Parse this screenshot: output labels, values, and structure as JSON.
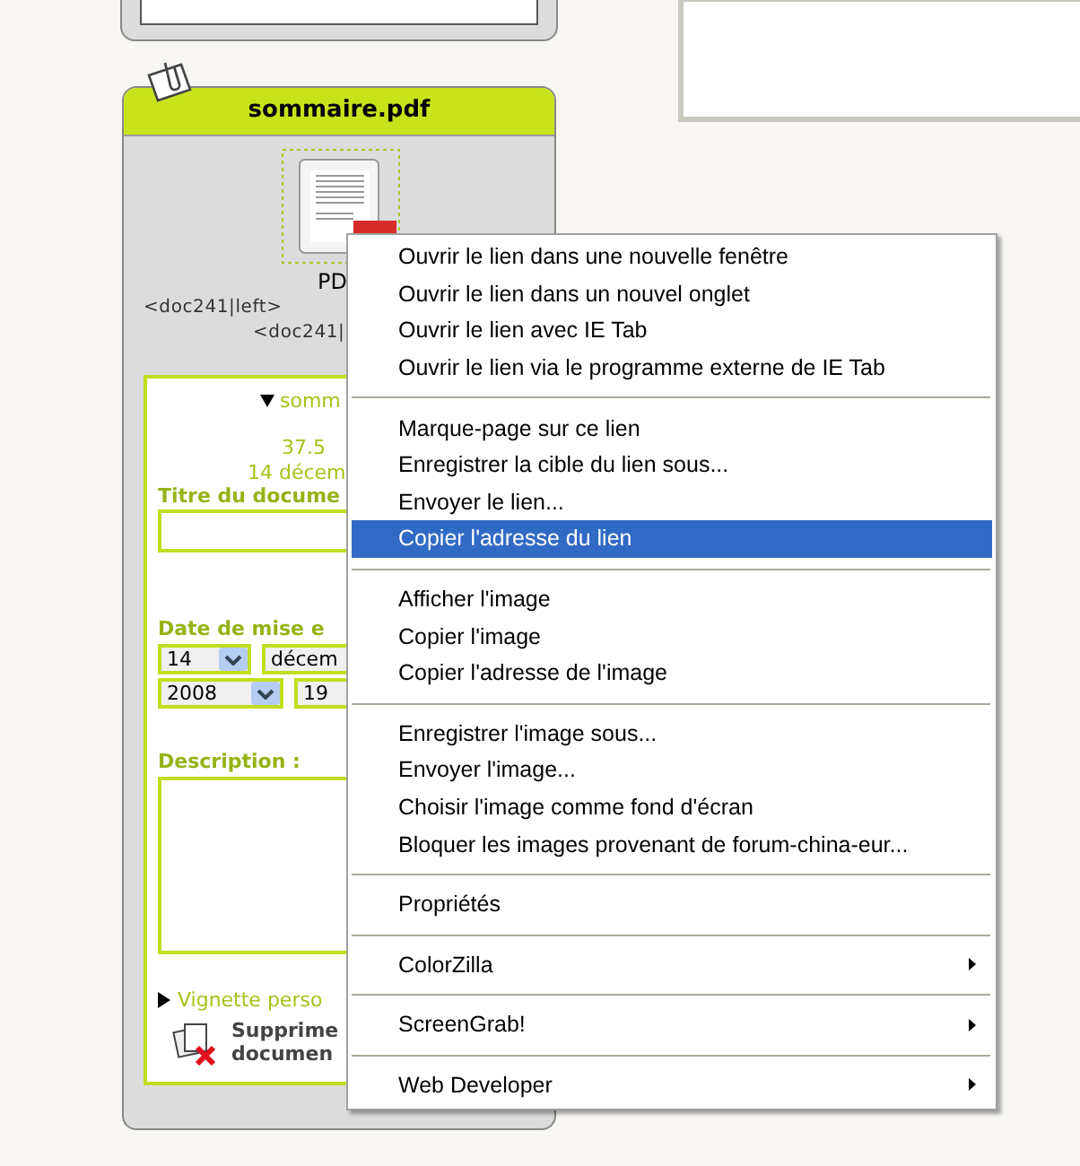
{
  "card": {
    "title": "sommaire.pdf",
    "thumbnail_caption": "PD",
    "code_lines": [
      "<doc241|left>",
      "<doc241|"
    ],
    "form": {
      "details_toggle": "somm",
      "size": "37.5",
      "date": "14 décem",
      "title_label": "Titre du docume",
      "date_label": "Date de mise e",
      "day": "14",
      "month": "décem",
      "year": "2008",
      "hour": "19",
      "description_label": "Description :",
      "thumbnail_toggle": "Vignette perso",
      "delete_label": [
        "Supprime",
        "documen"
      ]
    }
  },
  "context_menu": {
    "groups": [
      [
        {
          "label": "Ouvrir le lien dans une nouvelle fenêtre",
          "selected": false,
          "submenu": false
        },
        {
          "label": "Ouvrir le lien dans un nouvel onglet",
          "selected": false,
          "submenu": false
        },
        {
          "label": "Ouvrir le lien avec IE Tab",
          "selected": false,
          "submenu": false
        },
        {
          "label": "Ouvrir le lien via le programme externe de IE Tab",
          "selected": false,
          "submenu": false
        }
      ],
      [
        {
          "label": "Marque-page sur ce lien",
          "selected": false,
          "submenu": false
        },
        {
          "label": "Enregistrer la cible du lien sous...",
          "selected": false,
          "submenu": false
        },
        {
          "label": "Envoyer le lien...",
          "selected": false,
          "submenu": false
        },
        {
          "label": "Copier l'adresse du lien",
          "selected": true,
          "submenu": false
        }
      ],
      [
        {
          "label": "Afficher l'image",
          "selected": false,
          "submenu": false
        },
        {
          "label": "Copier l'image",
          "selected": false,
          "submenu": false
        },
        {
          "label": "Copier l'adresse de l'image",
          "selected": false,
          "submenu": false
        }
      ],
      [
        {
          "label": "Enregistrer l'image sous...",
          "selected": false,
          "submenu": false
        },
        {
          "label": "Envoyer l'image...",
          "selected": false,
          "submenu": false
        },
        {
          "label": "Choisir l'image comme fond d'écran",
          "selected": false,
          "submenu": false
        },
        {
          "label": "Bloquer les images provenant de forum-china-eur...",
          "selected": false,
          "submenu": false
        }
      ],
      [
        {
          "label": "Propriétés",
          "selected": false,
          "submenu": false
        }
      ],
      [
        {
          "label": "ColorZilla",
          "selected": false,
          "submenu": true
        }
      ],
      [
        {
          "label": "ScreenGrab!",
          "selected": false,
          "submenu": true
        }
      ],
      [
        {
          "label": "Web Developer",
          "selected": false,
          "submenu": true
        }
      ]
    ]
  }
}
